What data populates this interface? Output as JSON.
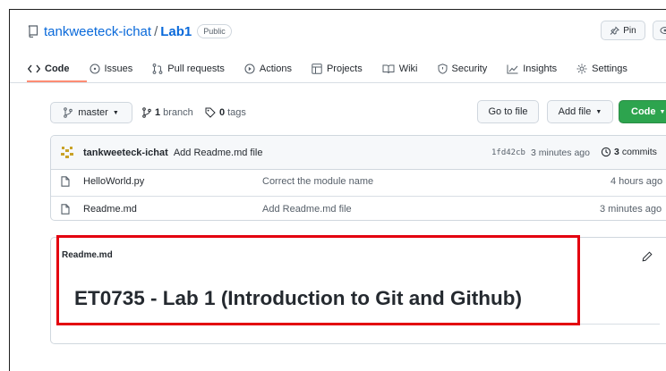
{
  "repo": {
    "owner": "tankweeteck-ichat",
    "separator": "/",
    "name": "Lab1",
    "visibility": "Public"
  },
  "header_buttons": {
    "pin": "Pin"
  },
  "tabs": [
    {
      "label": "Code",
      "icon": "code-icon",
      "active": true
    },
    {
      "label": "Issues",
      "icon": "issue-opened-icon"
    },
    {
      "label": "Pull requests",
      "icon": "git-pull-request-icon"
    },
    {
      "label": "Actions",
      "icon": "play-icon"
    },
    {
      "label": "Projects",
      "icon": "table-icon"
    },
    {
      "label": "Wiki",
      "icon": "book-icon"
    },
    {
      "label": "Security",
      "icon": "shield-icon"
    },
    {
      "label": "Insights",
      "icon": "graph-icon"
    },
    {
      "label": "Settings",
      "icon": "gear-icon"
    }
  ],
  "toolbar": {
    "branch": "master",
    "branch_count": "1",
    "branch_label": "branch",
    "tag_count": "0",
    "tag_label": "tags",
    "go_to_file": "Go to file",
    "add_file": "Add file",
    "code": "Code"
  },
  "latest_commit": {
    "author": "tankweeteck-ichat",
    "message": "Add Readme.md file",
    "sha": "1fd42cb",
    "time": "3 minutes ago",
    "commit_count": "3",
    "commit_label": "commits"
  },
  "files": [
    {
      "name": "HelloWorld.py",
      "message": "Correct the module name",
      "time": "4 hours ago"
    },
    {
      "name": "Readme.md",
      "message": "Add Readme.md file",
      "time": "3 minutes ago"
    }
  ],
  "readme": {
    "filename": "Readme.md",
    "heading": "ET0735 - Lab 1 (Introduction to Git and Github)"
  },
  "colors": {
    "accent_link": "#0969da",
    "tab_underline": "#fd8c73",
    "code_button": "#2da44e",
    "highlight": "#e3000f"
  }
}
